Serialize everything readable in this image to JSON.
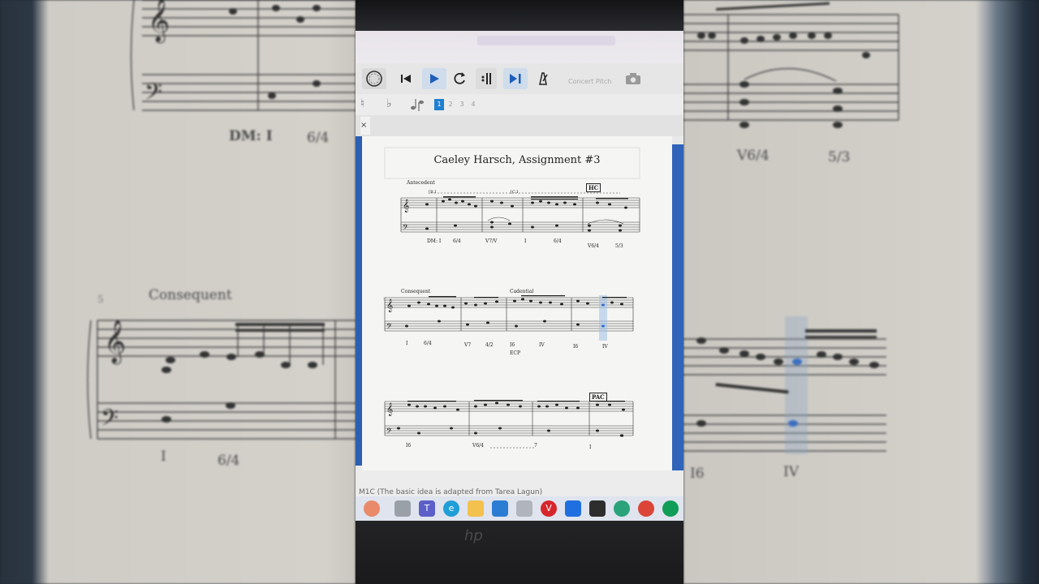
{
  "score": {
    "title": "Caeley Harsch, Assignment #3",
    "sections": {
      "antecedent": "Antecedent",
      "consequent": "Consequent",
      "cadential": "Cadential"
    },
    "brackets": {
      "bi": "[B.I",
      "ci": "[C.I"
    },
    "boxes": {
      "hc": "HC",
      "pac": "PAC"
    },
    "system1_romans": [
      "DM: I",
      "6/4",
      "V7/V",
      "I",
      "6/4",
      "V6/4",
      "5/3"
    ],
    "system2_romans": [
      "I",
      "6/4",
      "V7",
      "4/2",
      "I6",
      "IV",
      "I6",
      "IV"
    ],
    "system2_extra": "ECP",
    "system3_romans": [
      "I6",
      "V6/4",
      "7",
      "I"
    ],
    "measure_number_5": "5"
  },
  "background": {
    "left_labels": [
      "DM: I",
      "6/4",
      "Consequent",
      "I",
      "6/4",
      "5"
    ],
    "right_labels": [
      "V6/4",
      "5/3",
      "I6",
      "IV"
    ]
  },
  "toolbar": {
    "concert_pitch": "Concert Pitch",
    "icons": [
      "metronome-icon",
      "rewind-icon",
      "play-icon",
      "loop-icon",
      "play-repeats-icon",
      "pan-score-icon",
      "mixer-icon",
      "camera-icon"
    ]
  },
  "palette": {
    "accidentals": [
      "♮",
      "♭"
    ],
    "pages": [
      "1",
      "2",
      "3",
      "4"
    ]
  },
  "doc_tab": {
    "close": "×"
  },
  "status_bar": {
    "text": "M1C (The basic idea is adapted from Tarea Lagun)"
  },
  "taskbar": {
    "apps": [
      "app-icon",
      "file-icon",
      "teams-icon",
      "edge-icon",
      "folder-icon",
      "mail-icon",
      "store-icon",
      "vivaldi-icon",
      "dropbox-icon",
      "terminal-icon",
      "sync-icon",
      "chrome-icon",
      "chrome-icon-2"
    ]
  },
  "device": {
    "brand": "hp"
  },
  "colors": {
    "accent_blue": "#2c5fb1",
    "page_selected": "#1f7fd1",
    "play_active": "#cfdcec"
  }
}
